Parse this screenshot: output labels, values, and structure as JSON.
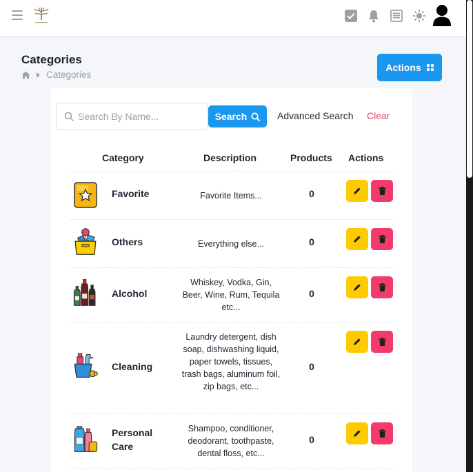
{
  "navbar": {
    "icons": [
      "menu-icon",
      "logo",
      "task-check-icon",
      "bell-icon",
      "news-icon",
      "sun-icon",
      "user-avatar-icon"
    ]
  },
  "header": {
    "title": "Categories",
    "breadcrumb": {
      "current": "Categories"
    },
    "actions_label": "Actions"
  },
  "search": {
    "placeholder": "Search By Name...",
    "value": "",
    "button_label": "Search",
    "advanced_label": "Advanced Search",
    "clear_label": "Clear"
  },
  "table": {
    "columns": [
      "Category",
      "Description",
      "Products",
      "Actions"
    ],
    "rows": [
      {
        "name": "Favorite",
        "description": "Favorite Items...",
        "products": "0",
        "icon": "star-bookmark-icon"
      },
      {
        "name": "Others",
        "description": "Everything else...",
        "products": "0",
        "icon": "box-balloons-icon"
      },
      {
        "name": "Alcohol",
        "description": "Whiskey, Vodka, Gin, Beer, Wine, Rum, Tequila etc...",
        "products": "0",
        "icon": "bottles-icon"
      },
      {
        "name": "Cleaning",
        "description": "Laundry detergent, dish soap, dishwashing liquid, paper towels, tissues, trash bags, aluminum foil, zip bags, etc...",
        "products": "0",
        "icon": "cleaning-bucket-icon"
      },
      {
        "name": "Personal Care",
        "description": "Shampoo, conditioner, deodorant, toothpaste, dental floss, etc...",
        "products": "0",
        "icon": "toiletries-icon"
      }
    ]
  },
  "colors": {
    "primary": "#1a98f0",
    "edit": "#fecb00",
    "delete": "#f23b6a",
    "clear": "#e5466b"
  }
}
